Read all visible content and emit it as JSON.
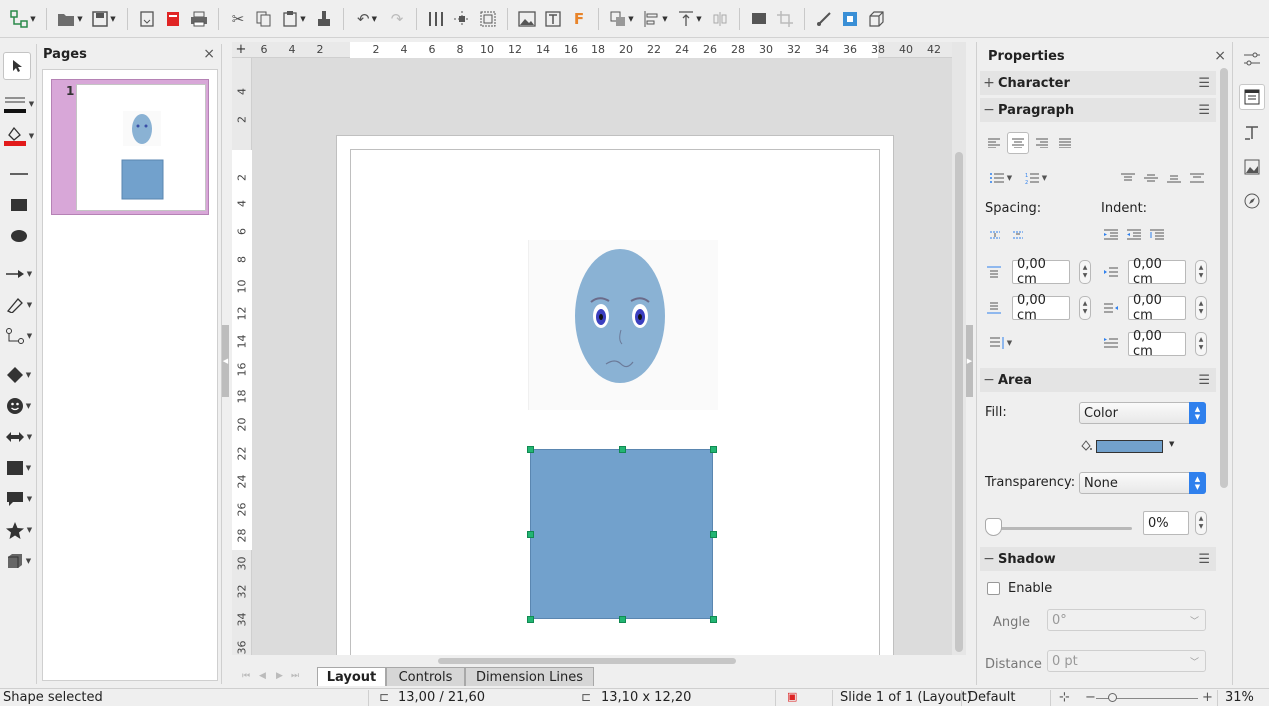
{
  "toolbar": {
    "icons": [
      "slide-layout-icon",
      "open-icon",
      "save-icon",
      "export-icon",
      "export-pdf-icon",
      "print-icon",
      "cut-icon",
      "copy-icon",
      "paste-icon",
      "clone-formatting-icon",
      "undo-icon",
      "redo-icon",
      "grid-icon",
      "helplines-icon",
      "zoom-pan-icon",
      "image-icon",
      "textbox-icon",
      "fontwork-icon",
      "transformations-icon",
      "align-icon",
      "arrange-icon",
      "distribute-icon",
      "shadow-icon",
      "crop-icon",
      "points-icon",
      "toggle-glue-icon",
      "extrusion-icon"
    ]
  },
  "pages_panel": {
    "title": "Pages",
    "close": "×",
    "slide_number": "1"
  },
  "ruler": {
    "h_ticks": [
      "6",
      "4",
      "2",
      "2",
      "4",
      "6",
      "8",
      "10",
      "12",
      "14",
      "16",
      "18",
      "20",
      "22",
      "24",
      "26",
      "28",
      "30",
      "32",
      "34",
      "36",
      "38",
      "40",
      "42"
    ],
    "v_ticks": [
      "4",
      "2",
      "2",
      "4",
      "6",
      "8",
      "10",
      "12",
      "14",
      "16",
      "18",
      "20",
      "22",
      "24",
      "26",
      "28",
      "30",
      "32",
      "34",
      "36"
    ]
  },
  "tabs": {
    "layout": "Layout",
    "controls": "Controls",
    "dimension_lines": "Dimension Lines"
  },
  "properties": {
    "title": "Properties",
    "close": "×",
    "character_header": "Character",
    "paragraph_header": "Paragraph",
    "spacing_label": "Spacing:",
    "indent_label": "Indent:",
    "above_spacing": "0,00 cm",
    "below_spacing": "0,00 cm",
    "before_indent": "0,00 cm",
    "after_indent": "0,00 cm",
    "first_line_indent": "0,00 cm",
    "area_header": "Area",
    "fill_label": "Fill:",
    "fill_value": "Color",
    "fill_color": "#72a1cc",
    "transparency_label": "Transparency:",
    "transparency_value": "None",
    "transparency_percent": "0%",
    "shadow_header": "Shadow",
    "enable_label": "Enable",
    "angle_label": "Angle",
    "angle_value": "0°",
    "distance_label": "Distance",
    "distance_value": "0 pt"
  },
  "status": {
    "shape_selected": "Shape selected",
    "position": "13,00 / 21,60",
    "size": "13,10 x 12,20",
    "slide_info": "Slide 1 of 1 (Layout)",
    "master": "Default",
    "zoom": "31%"
  },
  "colors": {
    "selection_handle": "#22b573",
    "rectangle_fill": "#72a1cc",
    "face_fill": "#8ab2d4",
    "slide_thumb_selected": "#d8a7d8"
  }
}
